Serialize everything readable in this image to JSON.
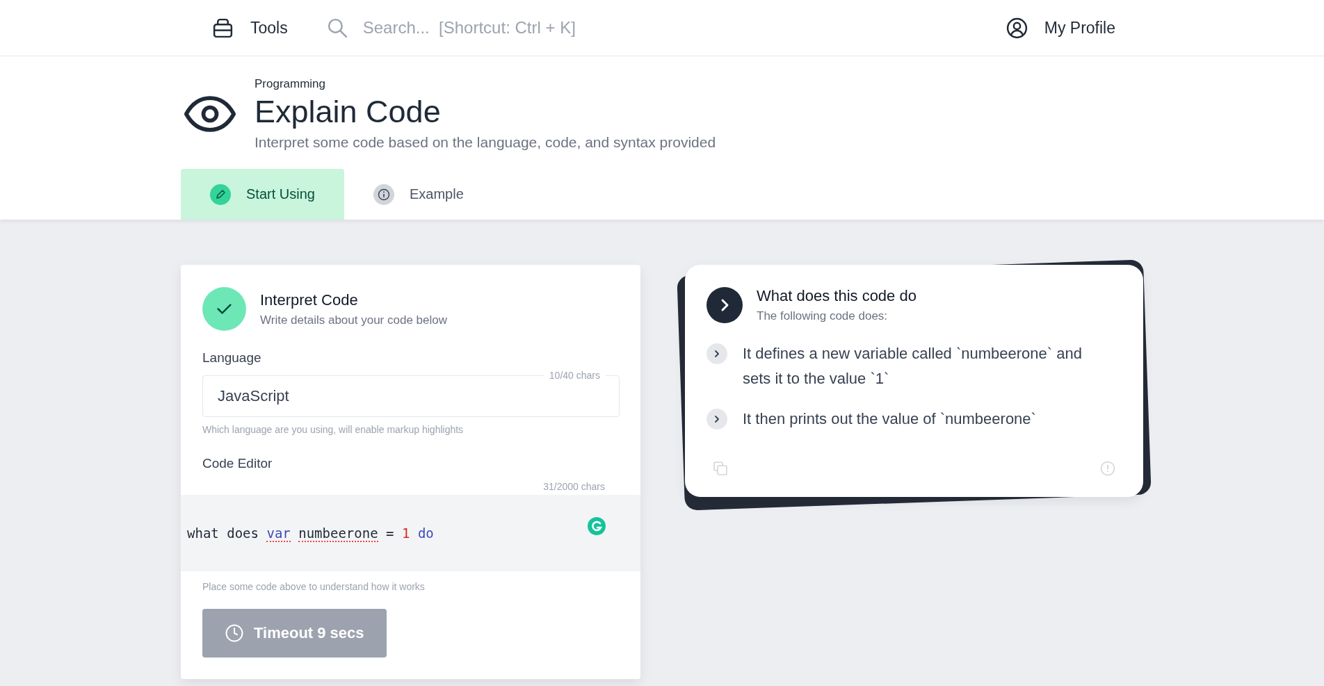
{
  "header": {
    "brand": {
      "label": "Tools"
    },
    "search": {
      "placeholder": "Search...  [Shortcut: Ctrl + K]"
    },
    "profile": {
      "label": "My Profile"
    }
  },
  "page": {
    "category": "Programming",
    "title": "Explain Code",
    "subtitle": "Interpret some code based on the language, code, and syntax provided"
  },
  "tabs": [
    {
      "label": "Start Using",
      "selected": true
    },
    {
      "label": "Example",
      "selected": false
    }
  ],
  "form_card": {
    "title": "Interpret Code",
    "subtitle": "Write details about your code below",
    "language": {
      "label": "Language",
      "value": "JavaScript",
      "counter": "10/40 chars",
      "help": "Which language are you using, will enable markup highlights"
    },
    "editor": {
      "label": "Code Editor",
      "counter": "31/2000 chars",
      "help": "Place some code above to understand how it works",
      "tokens": [
        {
          "text": "what",
          "kind": "plain",
          "misspelled": false
        },
        {
          "text": "does",
          "kind": "plain",
          "misspelled": false
        },
        {
          "text": "var",
          "kind": "keyword",
          "misspelled": true
        },
        {
          "text": "numbeerone",
          "kind": "plain",
          "misspelled": true
        },
        {
          "text": "=",
          "kind": "plain",
          "misspelled": false
        },
        {
          "text": "1",
          "kind": "number",
          "misspelled": false
        },
        {
          "text": "do",
          "kind": "keyword",
          "misspelled": false
        }
      ]
    },
    "button": {
      "label": "Timeout 9 secs",
      "disabled": true
    }
  },
  "result_card": {
    "title": "What does this code do",
    "subtitle": "The following code does:",
    "items": [
      {
        "text": "It defines a new variable called `numbeerone` and sets it to the value `1`"
      },
      {
        "text": "It then prints out the value of `numbeerone`"
      }
    ]
  }
}
